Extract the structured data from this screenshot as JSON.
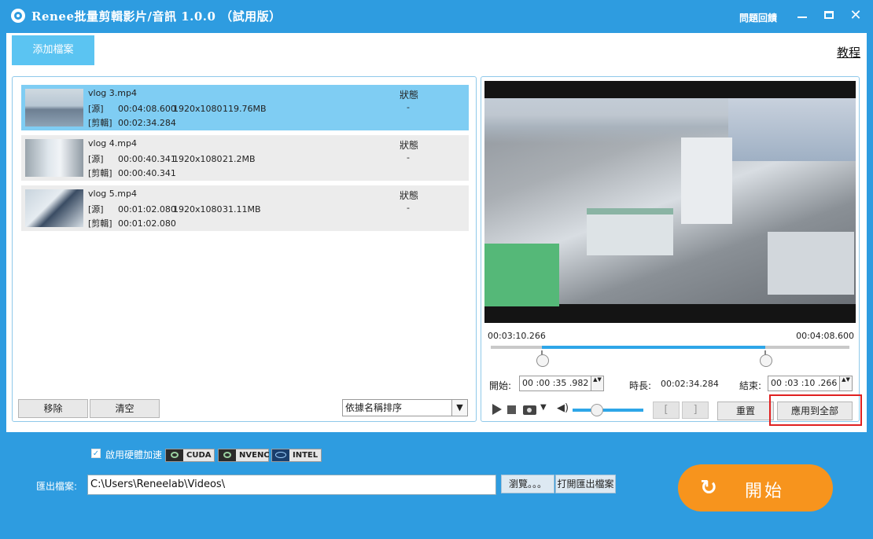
{
  "window": {
    "title": "Renee批量剪輯影片/音訊 1.0.0 （試用版）",
    "feedback": "問題回饋",
    "minimize_icon": "minimize-icon",
    "maximize_icon": "maximize-icon",
    "close_glyph": "✕"
  },
  "toolbar": {
    "add_file": "添加檔案",
    "tutorial": "教程"
  },
  "files": [
    {
      "name": "vlog 3.mp4",
      "src_tag": "[源]",
      "src_duration": "00:04:08.600",
      "resolution": "1920x1080",
      "size": "119.76MB",
      "clip_tag": "[剪輯]",
      "clip_duration": "00:02:34.284",
      "status_label": "狀態",
      "status_value": "-"
    },
    {
      "name": "vlog 4.mp4",
      "src_tag": "[源]",
      "src_duration": "00:00:40.341",
      "resolution": "1920x1080",
      "size": "21.2MB",
      "clip_tag": "[剪輯]",
      "clip_duration": "00:00:40.341",
      "status_label": "狀態",
      "status_value": "-"
    },
    {
      "name": "vlog 5.mp4",
      "src_tag": "[源]",
      "src_duration": "00:01:02.080",
      "resolution": "1920x1080",
      "size": "31.11MB",
      "clip_tag": "[剪輯]",
      "clip_duration": "00:01:02.080",
      "status_label": "狀態",
      "status_value": "-"
    }
  ],
  "list_actions": {
    "remove": "移除",
    "clear": "清空",
    "sort_selected": "依據名稱排序",
    "sort_arrow": "▼"
  },
  "player": {
    "current_time": "00:03:10.266",
    "total_time": "00:04:08.600",
    "range_start_fraction": 0.1426,
    "range_end_fraction": 0.7655,
    "volume_fraction": 0.25,
    "start_label": "開始:",
    "start_value": "00 :00 :35 .982",
    "duration_label": "時長:",
    "duration_value": "00:02:34.284",
    "end_label": "結束:",
    "end_value": "00 :03 :10 .266",
    "spin_glyph": "▲▼",
    "mark_in": "[",
    "mark_out": "]",
    "dropdown_glyph": "▼",
    "volume_glyph": "◀)",
    "reset": "重置",
    "apply_all": "應用到全部"
  },
  "settings": {
    "hw_accel_checked": "✓",
    "hw_accel_label": "啟用硬體加速",
    "badges": [
      "CUDA",
      "NVENC",
      "INTEL"
    ],
    "output_label": "匯出檔案:",
    "output_path": "C:\\Users\\Reneelab\\Videos\\",
    "browse": "瀏覽。。。",
    "open_folder": "打開匯出檔案"
  },
  "start": {
    "icon_glyph": "↻",
    "label": "開始"
  },
  "colors": {
    "accent": "#2e9ce0",
    "selected_row": "#7fcdf3",
    "start_button": "#f7941d",
    "highlight": "#e02020"
  }
}
